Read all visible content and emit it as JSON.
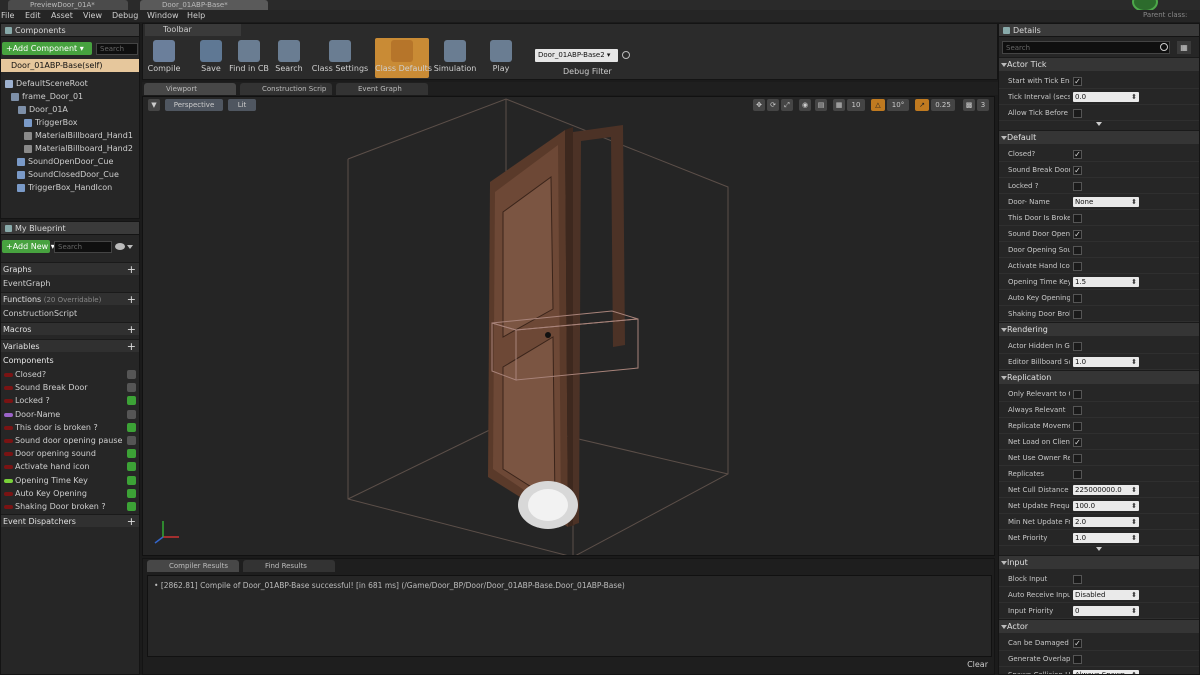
{
  "tabs": [
    {
      "label": "PreviewDoor_01A*"
    },
    {
      "label": "Door_01ABP-Base*"
    }
  ],
  "parent_class": "Parent class:",
  "menu": [
    "File",
    "Edit",
    "Asset",
    "View",
    "Debug",
    "Window",
    "Help"
  ],
  "components_panel": {
    "title": "Components",
    "add_label": "+Add Component ▾",
    "search_placeholder": "Search",
    "self_label": "Door_01ABP-Base(self)",
    "tree": [
      "DefaultSceneRoot",
      "frame_Door_01",
      "Door_01A",
      "TriggerBox",
      "MaterialBillboard_Hand1",
      "MaterialBillboard_Hand2",
      "SoundOpenDoor_Cue",
      "SoundClosedDoor_Cue",
      "TriggerBox_HandIcon"
    ]
  },
  "my_blueprint": {
    "title": "My Blueprint",
    "add_label": "+Add New ▾",
    "search_placeholder": "Search",
    "graphs_label": "Graphs",
    "event_graph": "EventGraph",
    "functions_label": "Functions",
    "functions_note": "(20 Overridable)",
    "construction": "ConstructionScript",
    "macros_label": "Macros",
    "variables_label": "Variables",
    "components_label": "Components",
    "variables": [
      {
        "name": "Closed?",
        "color": "#7a1313",
        "visible": false
      },
      {
        "name": "Sound Break Door",
        "color": "#7a1313",
        "visible": false
      },
      {
        "name": "Locked ?",
        "color": "#7a1313",
        "visible": true
      },
      {
        "name": "Door-Name",
        "color": "#9b63c7",
        "visible": false
      },
      {
        "name": "This door is broken ?",
        "color": "#7a1313",
        "visible": true
      },
      {
        "name": "Sound door opening pause",
        "color": "#7a1313",
        "visible": false
      },
      {
        "name": "Door opening sound",
        "color": "#7a1313",
        "visible": true
      },
      {
        "name": "Activate hand icon",
        "color": "#7a1313",
        "visible": true
      },
      {
        "name": "Opening Time Key",
        "color": "#7ad13a",
        "visible": true
      },
      {
        "name": "Auto Key Opening",
        "color": "#7a1313",
        "visible": true
      },
      {
        "name": "Shaking Door broken ?",
        "color": "#7a1313",
        "visible": true
      }
    ],
    "dispatchers_label": "Event Dispatchers"
  },
  "toolbar": {
    "title": "Toolbar",
    "buttons": [
      {
        "label": "Compile",
        "color": "#6b7f9b"
      },
      {
        "label": "Save",
        "color": "#5f7894"
      },
      {
        "label": "Find in CB",
        "color": "#6a7d92"
      },
      {
        "label": "Search",
        "color": "#6a7d92"
      },
      {
        "label": "Class Settings",
        "color": "#6a7d92"
      },
      {
        "label": "Class Defaults",
        "color": "#b6752a"
      },
      {
        "label": "Simulation",
        "color": "#6a7d92"
      },
      {
        "label": "Play",
        "color": "#6a7d92"
      }
    ],
    "debug_select": "Door_01ABP-Base2 ▾",
    "debug_label": "Debug Filter"
  },
  "editor_tabs": [
    "Viewport",
    "Construction Scrip",
    "Event Graph"
  ],
  "viewport": {
    "perspective": "Perspective",
    "lit": "Lit",
    "grid": "10",
    "angle": "10°",
    "scale": "0.25",
    "cams": "3"
  },
  "output": {
    "tabs": [
      "Compiler Results",
      "Find Results"
    ],
    "log": "[2862.81] Compile of Door_01ABP-Base successful! [in 681 ms] (/Game/Door_BP/Door/Door_01ABP-Base.Door_01ABP-Base)",
    "clear": "Clear"
  },
  "details": {
    "title": "Details",
    "search_placeholder": "Search",
    "sections": [
      {
        "name": "Actor Tick",
        "props": [
          {
            "label": "Start with Tick Enal",
            "type": "check",
            "checked": true
          },
          {
            "label": "Tick Interval (secs)",
            "type": "field",
            "value": "0.0"
          },
          {
            "label": "Allow Tick Before B",
            "type": "check",
            "checked": false
          }
        ]
      },
      {
        "name": "Default",
        "props": [
          {
            "label": "Closed?",
            "type": "check",
            "checked": true
          },
          {
            "label": "Sound Break Door",
            "type": "check",
            "checked": true
          },
          {
            "label": "Locked ?",
            "type": "check",
            "checked": false
          },
          {
            "label": "Door- Name",
            "type": "field",
            "value": "None"
          },
          {
            "label": "This Door Is Broken",
            "type": "check",
            "checked": false
          },
          {
            "label": "Sound Door Openin",
            "type": "check",
            "checked": true
          },
          {
            "label": "Door Opening Sound",
            "type": "check",
            "checked": false
          },
          {
            "label": "Activate Hand Icon",
            "type": "check",
            "checked": false
          },
          {
            "label": "Opening Time Key",
            "type": "field",
            "value": "1.5"
          },
          {
            "label": "Auto Key Opening",
            "type": "check",
            "checked": false
          },
          {
            "label": "Shaking Door Broke",
            "type": "check",
            "checked": false
          }
        ]
      },
      {
        "name": "Rendering",
        "props": [
          {
            "label": "Actor Hidden In Gar",
            "type": "check",
            "checked": false
          },
          {
            "label": "Editor Billboard Sca",
            "type": "field",
            "value": "1.0"
          }
        ]
      },
      {
        "name": "Replication",
        "props": [
          {
            "label": "Only Relevant to Ow",
            "type": "check",
            "checked": false
          },
          {
            "label": "Always Relevant",
            "type": "check",
            "checked": false
          },
          {
            "label": "Replicate Movemen",
            "type": "check",
            "checked": false
          },
          {
            "label": "Net Load on Client",
            "type": "check",
            "checked": true
          },
          {
            "label": "Net Use Owner Rele",
            "type": "check",
            "checked": false
          },
          {
            "label": "Replicates",
            "type": "check",
            "checked": false
          },
          {
            "label": "Net Cull Distance S",
            "type": "field",
            "value": "225000000.0"
          },
          {
            "label": "Net Update Frequer",
            "type": "field",
            "value": "100.0"
          },
          {
            "label": "Min Net Update Fre",
            "type": "field",
            "value": "2.0"
          },
          {
            "label": "Net Priority",
            "type": "field",
            "value": "1.0"
          }
        ]
      },
      {
        "name": "Input",
        "props": [
          {
            "label": "Block Input",
            "type": "check",
            "checked": false
          },
          {
            "label": "Auto Receive Input",
            "type": "field",
            "value": "Disabled"
          },
          {
            "label": "Input Priority",
            "type": "field",
            "value": "0"
          }
        ]
      },
      {
        "name": "Actor",
        "props": [
          {
            "label": "Can be Damaged",
            "type": "check",
            "checked": true
          },
          {
            "label": "Generate Overlap E",
            "type": "check",
            "checked": false
          },
          {
            "label": "Spawn Collision Ha",
            "type": "field",
            "value": "Always Spawn, Ignore Collisions"
          }
        ]
      }
    ]
  }
}
